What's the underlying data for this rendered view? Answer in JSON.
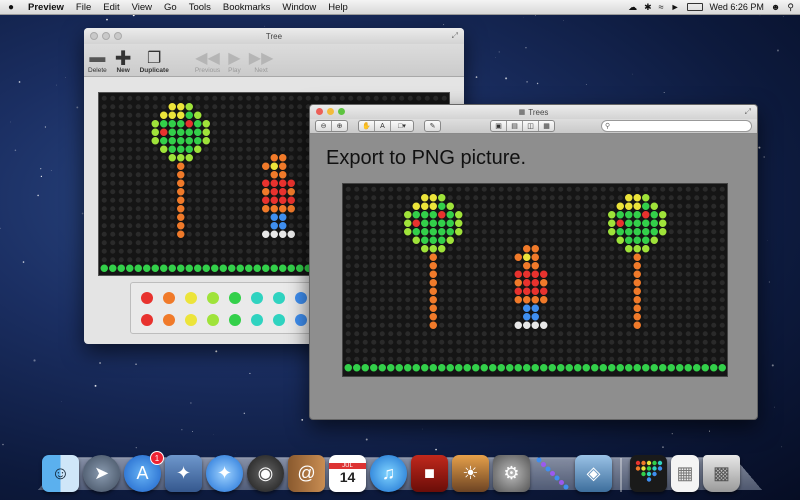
{
  "menubar": {
    "apple": "",
    "app": "Preview",
    "items": [
      "File",
      "Edit",
      "View",
      "Go",
      "Tools",
      "Bookmarks",
      "Window",
      "Help"
    ],
    "clock": "Wed 6:26 PM"
  },
  "win_tree": {
    "title": "Tree",
    "toolbar": [
      {
        "label": "Delete",
        "icon": "minus-icon"
      },
      {
        "label": "New",
        "icon": "plus-icon"
      },
      {
        "label": "Duplicate",
        "icon": "duplicate-icon"
      },
      {
        "label": "Previous",
        "icon": "previous-icon"
      },
      {
        "label": "Play",
        "icon": "play-icon"
      },
      {
        "label": "Next",
        "icon": "next-icon"
      }
    ]
  },
  "win_trees": {
    "title": "Trees",
    "caption": "Export to PNG picture.",
    "search_placeholder": ""
  },
  "colors": {
    "accent_red": "#e8322e",
    "orange": "#f07a2a",
    "yellow": "#ece43a",
    "lime": "#9fe33a",
    "green": "#33d04a",
    "teal": "#2fd3c0",
    "blue": "#3f8ff0",
    "peg": "#2a2a2a"
  },
  "dock": {
    "icons": [
      "finder-icon",
      "launchpad-icon",
      "app-store-icon",
      "mail-stamp-icon",
      "safari-icon",
      "facetime-icon",
      "address-book-icon",
      "calendar-icon",
      "itunes-icon",
      "photo-booth-icon",
      "iphoto-icon",
      "system-preferences-icon",
      "peg-app-icon",
      "preview-icon",
      "lite-brite-icon",
      "document-icon",
      "trash-icon"
    ],
    "calendar_month": "JUL",
    "calendar_day": "14",
    "app_store_badge": "1"
  }
}
